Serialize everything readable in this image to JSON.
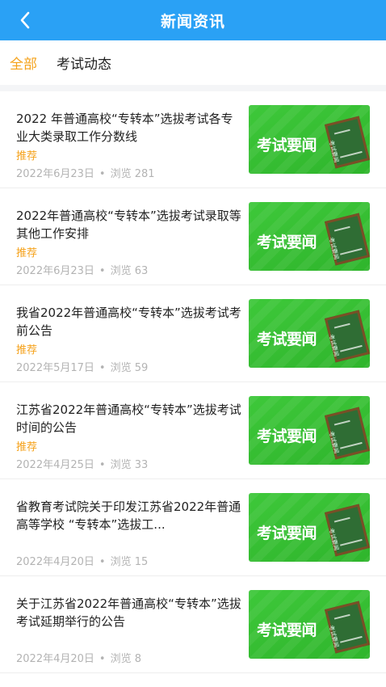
{
  "header": {
    "title": "新闻资讯"
  },
  "tabs": [
    {
      "label": "全部",
      "active": true
    },
    {
      "label": "考试动态",
      "active": false
    }
  ],
  "colors": {
    "header_bg": "#2aa1f5",
    "accent": "#f5a21b",
    "thumb_green": "#3ec83a"
  },
  "thumb_text": "考试要闻",
  "board_label": "考试要闻",
  "items": [
    {
      "title": "2022 年普通高校“专转本”选拔考试各专业大类录取工作分数线",
      "tag": "推荐",
      "date": "2022年6月23日",
      "views": "浏览 281"
    },
    {
      "title": "2022年普通高校“专转本”选拔考试录取等其他工作安排",
      "tag": "推荐",
      "date": "2022年6月23日",
      "views": "浏览 63"
    },
    {
      "title": "我省2022年普通高校“专转本”选拔考试考前公告",
      "tag": "推荐",
      "date": "2022年5月17日",
      "views": "浏览 59"
    },
    {
      "title": "江苏省2022年普通高校“专转本”选拔考试时间的公告",
      "tag": "推荐",
      "date": "2022年4月25日",
      "views": "浏览 33"
    },
    {
      "title": "省教育考试院关于印发江苏省2022年普通高等学校 “专转本”选拔工...",
      "tag": "",
      "date": "2022年4月20日",
      "views": "浏览 15"
    },
    {
      "title": "关于江苏省2022年普通高校“专转本”选拔考试延期举行的公告",
      "tag": "",
      "date": "2022年4月20日",
      "views": "浏览 8"
    }
  ]
}
